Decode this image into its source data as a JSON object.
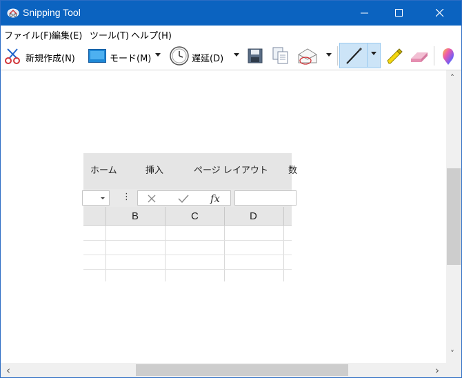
{
  "window": {
    "title": "Snipping Tool",
    "accent_color": "#0b63c0",
    "icons": [
      "snipping-tool-app-icon",
      "minimize-icon",
      "maximize-icon",
      "close-icon"
    ]
  },
  "menu": {
    "file": "ファイル(F)",
    "edit": "編集(E)",
    "tools": "ツール(T)",
    "help": "ヘルプ(H)"
  },
  "toolbar": {
    "new_label": "新規作成(N)",
    "mode_label": "モード(M)",
    "delay_label": "遅延(D)",
    "icons": [
      "scissors-icon",
      "mode-rect-icon",
      "clock-icon",
      "save-icon",
      "copy-icon",
      "send-mail-icon",
      "pen-icon",
      "highlighter-icon",
      "eraser-icon",
      "paint3d-icon"
    ],
    "active_tool": "pen"
  },
  "snip": {
    "ribbon_tabs": [
      "ホーム",
      "挿入",
      "ページ レイアウト",
      "数"
    ],
    "formula_icons": [
      "cancel-x-icon",
      "enter-check-icon",
      "fx-icon"
    ],
    "fx_label": "fx",
    "dots": "⋮",
    "columns": [
      "B",
      "C",
      "D"
    ]
  },
  "scrollbars": {
    "up": "˄",
    "down": "˅",
    "left": "‹",
    "right": "›"
  }
}
